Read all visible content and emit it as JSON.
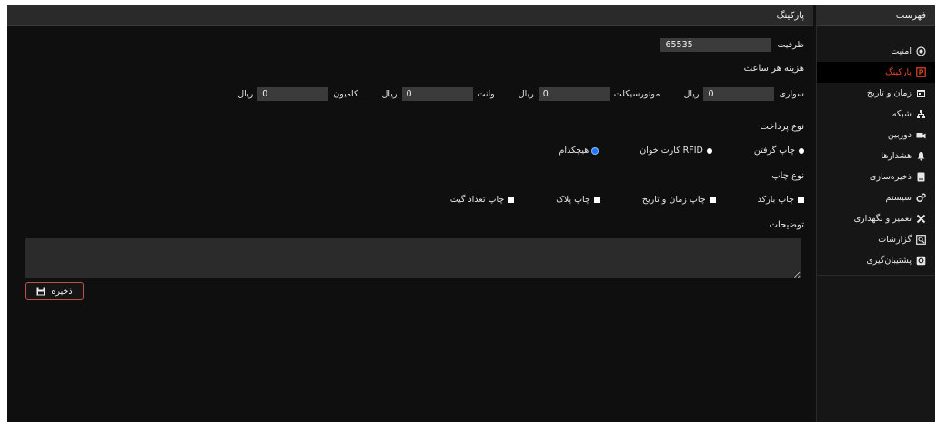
{
  "sidebar": {
    "title": "فهرست",
    "items": [
      {
        "label": "امنیت",
        "icon": "shield-icon",
        "active": false
      },
      {
        "label": "پارکینگ",
        "icon": "parking-icon",
        "active": true
      },
      {
        "label": "زمان و تاریخ",
        "icon": "calendar-icon",
        "active": false
      },
      {
        "label": "شبکه",
        "icon": "network-icon",
        "active": false
      },
      {
        "label": "دوربین",
        "icon": "camera-icon",
        "active": false
      },
      {
        "label": "هشدارها",
        "icon": "bell-icon",
        "active": false
      },
      {
        "label": "ذخیره‌سازی",
        "icon": "storage-icon",
        "active": false
      },
      {
        "label": "سیستم",
        "icon": "gears-icon",
        "active": false
      },
      {
        "label": "تعمیر و نگهداری",
        "icon": "tools-icon",
        "active": false
      },
      {
        "label": "گزارشات",
        "icon": "report-icon",
        "active": false
      },
      {
        "label": "پشتیبان‌گیری",
        "icon": "backup-icon",
        "active": false
      }
    ]
  },
  "main": {
    "title": "پارکینگ",
    "capacity": {
      "label": "ظرفیت",
      "value": "65535"
    },
    "hourly_cost": {
      "title": "هزینه هر ساعت",
      "unit": "ریال",
      "items": [
        {
          "label": "سواری",
          "value": "0"
        },
        {
          "label": "موتورسیکلت",
          "value": "0"
        },
        {
          "label": "وانت",
          "value": "0"
        },
        {
          "label": "کامیون",
          "value": "0"
        }
      ]
    },
    "payment_type": {
      "title": "نوع پرداخت",
      "options": [
        {
          "label": "چاپ گرفتن",
          "selected": false
        },
        {
          "label": "کارت خوان RFID",
          "selected": false
        },
        {
          "label": "هیچکدام",
          "selected": true
        }
      ]
    },
    "print_type": {
      "title": "نوع چاپ",
      "options": [
        {
          "label": "چاپ بارکد"
        },
        {
          "label": "چاپ زمان و تاریخ"
        },
        {
          "label": "چاپ پلاک"
        },
        {
          "label": "چاپ تعداد گیت"
        }
      ]
    },
    "description": {
      "label": "توضیحات",
      "value": ""
    },
    "save_label": "ذخیره"
  },
  "colors": {
    "accent": "#e8462f",
    "selected_radio": "#1e78ff",
    "panel": "#0f0f0f",
    "header": "#2a2a2a"
  }
}
